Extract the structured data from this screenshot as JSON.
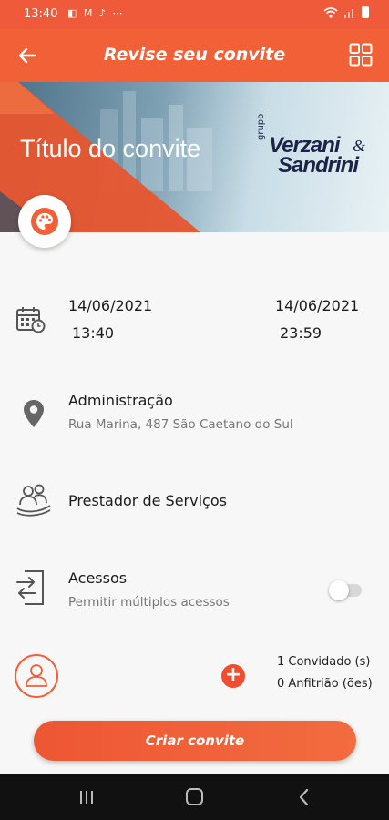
{
  "status_bar": {
    "time": "13:40",
    "notif_icons": "◧ M ♪ ⋯"
  },
  "app_bar": {
    "title": "Revise seu convite"
  },
  "banner": {
    "title": "Título do convite",
    "logo": {
      "grupo": "grupo",
      "line1": "Verzani",
      "amp": "&",
      "line2": "Sandrini"
    }
  },
  "schedule": {
    "start_date": "14/06/2021",
    "start_time": "13:40",
    "end_date": "14/06/2021",
    "end_time": "23:59"
  },
  "location": {
    "name": "Administração",
    "address": "Rua Marina, 487 São Caetano do Sul"
  },
  "visitor_type": {
    "label": "Prestador de Serviços"
  },
  "access": {
    "title": "Acessos",
    "subtitle": "Permitir múltiplos acessos",
    "multiple_enabled": false
  },
  "guests": {
    "guests_count": "1 Convidado (s)",
    "hosts_count": "0 Anfitrião (ões)",
    "add_symbol": "+"
  },
  "cta": {
    "label": "Criar convite"
  },
  "colors": {
    "accent": "#f26038",
    "status_bar": "#ef5a3a",
    "logo_navy": "#1c2347"
  }
}
